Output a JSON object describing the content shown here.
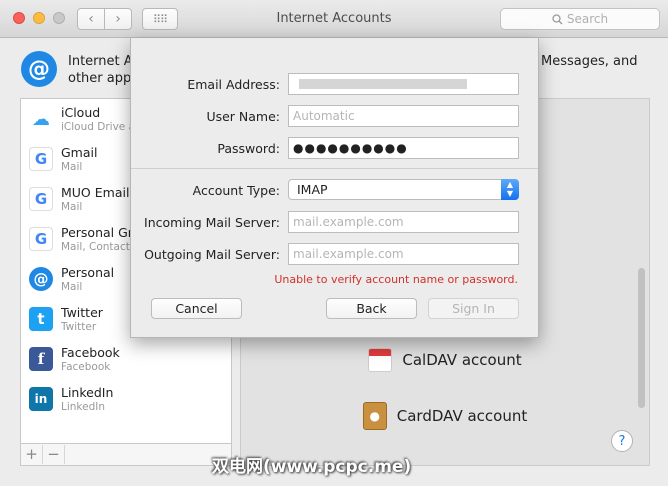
{
  "window": {
    "title": "Internet Accounts",
    "search_placeholder": "Search",
    "grid_glyph": "⠿⠿",
    "back_glyph": "‹",
    "forward_glyph": "›"
  },
  "header": {
    "text_left": "Internet Ac",
    "text_right": "Messages, and",
    "text_line2": "other apps"
  },
  "accounts": [
    {
      "name": "iCloud",
      "sub": "iCloud Drive a",
      "icon": "icloud-icon",
      "glyph": "☁"
    },
    {
      "name": "Gmail",
      "sub": "Mail",
      "icon": "google-icon",
      "glyph": "G"
    },
    {
      "name": "MUO Email",
      "sub": "Mail",
      "icon": "google-icon",
      "glyph": "G"
    },
    {
      "name": "Personal Gm",
      "sub": "Mail, Contacts",
      "icon": "google-icon",
      "glyph": "G"
    },
    {
      "name": "Personal",
      "sub": "Mail",
      "icon": "at-sign-icon",
      "glyph": "@"
    },
    {
      "name": "Twitter",
      "sub": "Twitter",
      "icon": "twitter-icon",
      "glyph": "t"
    },
    {
      "name": "Facebook",
      "sub": "Facebook",
      "icon": "facebook-icon",
      "glyph": "f"
    },
    {
      "name": "LinkedIn",
      "sub": "LinkedIn",
      "icon": "linkedin-icon",
      "glyph": "in"
    }
  ],
  "list_footer": {
    "add": "+",
    "remove": "−"
  },
  "providers": [
    {
      "label": "CalDAV account",
      "icon": "calendar-icon"
    },
    {
      "label": "CardDAV account",
      "icon": "contacts-book-icon"
    }
  ],
  "help_glyph": "?",
  "sheet": {
    "email_label": "Email Address:",
    "username_label": "User Name:",
    "username_placeholder": "Automatic",
    "password_label": "Password:",
    "password_value": "●●●●●●●●●●",
    "account_type_label": "Account Type:",
    "account_type_value": "IMAP",
    "incoming_label": "Incoming Mail Server:",
    "incoming_placeholder": "mail.example.com",
    "outgoing_label": "Outgoing Mail Server:",
    "outgoing_placeholder": "mail.example.com",
    "error_text": "Unable to verify account name or password.",
    "cancel_label": "Cancel",
    "back_label": "Back",
    "signin_label": "Sign In"
  },
  "watermark": "双电网(www.pcpc.me)",
  "colors": {
    "accent": "#1f88e5",
    "error": "#d2302a",
    "select_arrow": "#1570ee"
  }
}
